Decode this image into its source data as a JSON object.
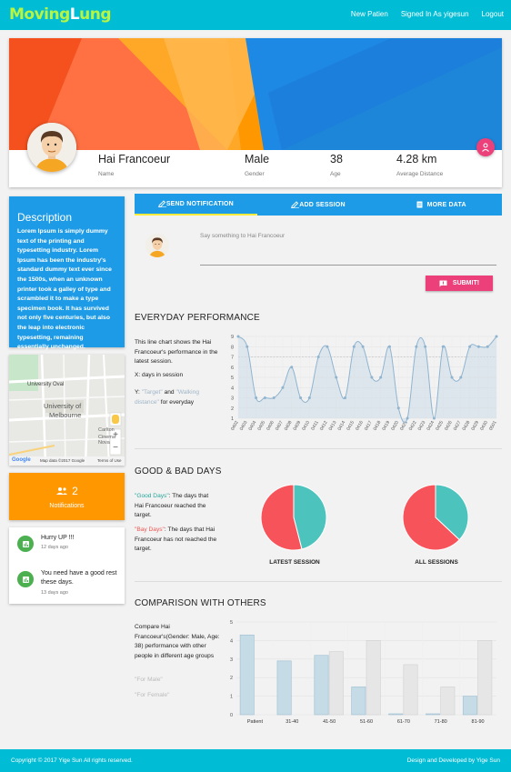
{
  "app": {
    "logo": "MovingLung",
    "logo_parts": [
      "Moving",
      "L",
      "ung"
    ],
    "nav": [
      "New Patien",
      "Signed In As yigesun",
      "Logout"
    ]
  },
  "patient": {
    "name": "Hai Francoeur",
    "name_label": "Name",
    "gender": "Male",
    "gender_label": "Gender",
    "age": "38",
    "age_label": "Age",
    "distance": "4.28 km",
    "distance_label": "Average Distance"
  },
  "description": {
    "title": "Description",
    "text": "Lorem Ipsum is simply dummy text of the printing and typesetting industry. Lorem Ipsum has been the industry's standard dummy text ever since the 1500s, when an unknown printer took a galley of type and scrambled it to make a type specimen book. It has survived not only five centuries, but also the leap into electronic typesetting, remaining essentially unchanged."
  },
  "map": {
    "labels": [
      "University Oval",
      "University of",
      "Melbourne",
      "Carlton",
      "Cinema Nova"
    ],
    "attribution": "Map data ©2017 Google",
    "terms": "Terms of Use",
    "google": "Google",
    "zoom_in": "+",
    "zoom_out": "−"
  },
  "notifications": {
    "count": "2",
    "label": "Notifications"
  },
  "messages": [
    {
      "text": "Hurry UP !!!",
      "date": "12 days ago"
    },
    {
      "text": "You need have a good rest these days.",
      "date": "13 days ago"
    }
  ],
  "tabs": [
    "SEND NOTIFICATION",
    "ADD SESSION",
    "MORE DATA"
  ],
  "session": {
    "placeholder": "Say something to Hai Francoeur",
    "submit": "SUBMIT!"
  },
  "performance": {
    "title": "EVERYDAY PERFORMANCE",
    "desc": "This line chart shows the Hai Francoeur's performance in the latest session.",
    "x_desc": "X: days in session",
    "y_prefix": "Y:",
    "target": "\"Target\"",
    "and": "and",
    "walking": "\"Walking distance\"",
    "y_suffix": "for everyday"
  },
  "goodbad": {
    "title": "GOOD & BAD DAYS",
    "good_label": "\"Good Days\"",
    "good_text": ": The days that Hai Francoeur reached the target.",
    "bad_label": "\"Bay Days\"",
    "bad_text": ": The days that Hai Francoeur has not reached the target.",
    "pie1_label": "LATEST SESSION",
    "pie2_label": "ALL SESSIONS"
  },
  "comparison": {
    "title": "COMPARISON WITH OTHERS",
    "desc": "Compare Hai Francoeur's(Gender: Male, Age: 38) performance with other people in different age groups",
    "for_male": "\"For Male\"",
    "for_female": "\"For Female\""
  },
  "footer": {
    "left": "Copyright © 2017 Yige Sun All rights reserved.",
    "right": "Design and Developed by Yige Sun"
  },
  "colors": {
    "primary": "#00bcd4",
    "blue": "#1e9be6",
    "pink": "#ec407a",
    "orange": "#ff9800",
    "green": "#4caf50",
    "pie_good": "#4dc3bd",
    "pie_bad": "#f7535a"
  },
  "chart_data": [
    {
      "type": "line",
      "title": "",
      "x": [
        "0402",
        "0403",
        "0404",
        "0405",
        "0406",
        "0407",
        "0408",
        "0409",
        "0410",
        "0411",
        "0412",
        "0413",
        "0414",
        "0415",
        "0416",
        "0417",
        "0418",
        "0419",
        "0420",
        "0421",
        "0422",
        "0423",
        "0424",
        "0425",
        "0426",
        "0427",
        "0428",
        "0429",
        "0430",
        "0501"
      ],
      "series": [
        {
          "values": [
            7,
            7,
            7,
            7,
            7,
            7,
            7,
            7,
            7,
            7,
            7,
            7,
            7,
            7,
            7,
            7,
            7,
            7,
            7,
            7,
            7,
            7,
            7,
            7,
            7,
            7,
            7,
            7,
            7,
            7
          ]
        },
        {
          "values": [
            9,
            8,
            3,
            3,
            3,
            4,
            6,
            3,
            3,
            7,
            8,
            5,
            3,
            8,
            8,
            5,
            5,
            8,
            2,
            1,
            8,
            8,
            1,
            8,
            5,
            5,
            8,
            8,
            8,
            9
          ]
        }
      ],
      "ylim": [
        1,
        9
      ],
      "yticks": [
        1,
        2,
        3,
        4,
        5,
        6,
        7,
        8,
        9
      ]
    },
    {
      "type": "pie",
      "title": "LATEST SESSION",
      "values": [
        46,
        54
      ]
    },
    {
      "type": "pie",
      "title": "ALL SESSIONS",
      "values": [
        37,
        63
      ]
    },
    {
      "type": "bar",
      "categories": [
        "Patient",
        "31-40",
        "41-50",
        "51-60",
        "61-70",
        "71-80",
        "81-90"
      ],
      "series": [
        {
          "name": "For Male",
          "values": [
            4.3,
            2.9,
            3.2,
            1.5,
            0.05,
            0.05,
            1.0
          ]
        },
        {
          "name": "For Female",
          "values": [
            0,
            0,
            3.4,
            4.0,
            2.7,
            1.5,
            4.0
          ]
        }
      ],
      "ylim": [
        0,
        5
      ],
      "yticks": [
        0,
        1,
        2,
        3,
        4,
        5
      ]
    }
  ]
}
